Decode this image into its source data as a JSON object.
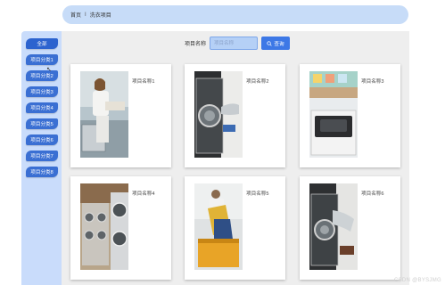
{
  "breadcrumb": {
    "home": "首页",
    "separator": "I",
    "current": "洗衣项目"
  },
  "sidebar": {
    "items": [
      {
        "label": "全部",
        "active": true
      },
      {
        "label": "项目分类1"
      },
      {
        "label": "项目分类2"
      },
      {
        "label": "项目分类3"
      },
      {
        "label": "项目分类4"
      },
      {
        "label": "项目分类5"
      },
      {
        "label": "项目分类6"
      },
      {
        "label": "项目分类7"
      },
      {
        "label": "项目分类8"
      }
    ]
  },
  "search": {
    "label": "项目名称",
    "placeholder": "项目名称",
    "button_label": "查询",
    "button_icon": "search-icon"
  },
  "cards": [
    {
      "title": "项目名称1"
    },
    {
      "title": "项目名称2"
    },
    {
      "title": "项目名称3"
    },
    {
      "title": "项目名称4"
    },
    {
      "title": "项目名称5"
    },
    {
      "title": "项目名称6"
    }
  ],
  "watermark": "CSDN @BYSJMG",
  "colors": {
    "accent": "#3d78e6",
    "sidebar_bg": "#c9dcfb",
    "breadcrumb_bg": "#c7dcf8",
    "panel_bg": "#eeeeee"
  }
}
